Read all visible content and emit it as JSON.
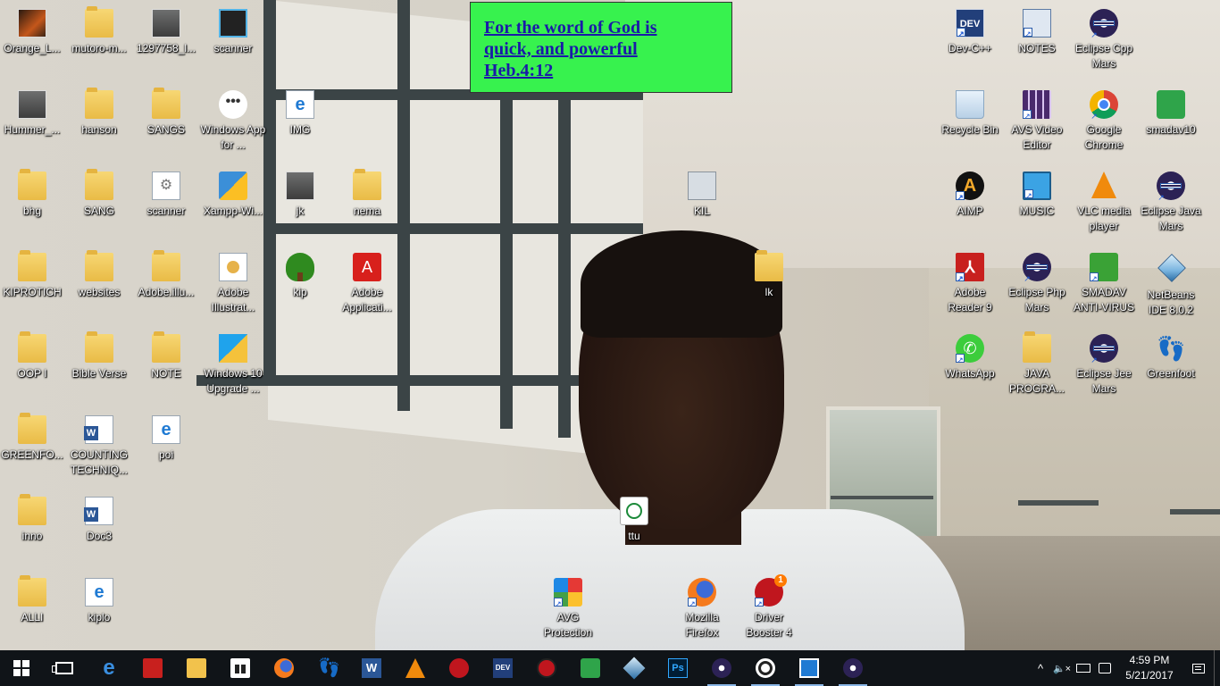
{
  "verse": {
    "line1": "For the word of God is",
    "line2": "quick, and powerful",
    "line3": "Heb.4:12"
  },
  "desktop_icons": {
    "orange_l": "Orange_L...",
    "mutoro": "mutoro-m...",
    "img1297758": "1297758_l...",
    "scanner_top": "scanner",
    "hummer": "Hummer_...",
    "hanson": "hanson",
    "sangs": "SANGS",
    "windows_app": "Windows App for ...",
    "img": "IMG",
    "bhg": "bhg",
    "sang": "SANG",
    "scanner": "scanner",
    "xampp": "Xampp-Wi...",
    "jk": "jk",
    "nema": "nema",
    "kiprotich": "KIPROTICH",
    "websites": "websites",
    "adobe_illu": "Adobe.illu...",
    "adobe_illustrat": "Adobe Illustrat...",
    "kip": "kip",
    "adobe_applicati": "Adobe Applicati...",
    "oop": "OOP I",
    "bible_verse": "Bible Verse",
    "note": "NOTE",
    "win10_upgrade": "Windows 10 Upgrade ...",
    "greenfo": "GREENFO...",
    "counting": "COUNTING TECHNIQ...",
    "poi": "poi",
    "inno": "inno",
    "doc3": "Doc3",
    "alli": "ALLI",
    "kiplo": "kiplo",
    "kil": "KIL",
    "lk": "lk",
    "ttu": "ttu",
    "avg": "AVG Protection",
    "firefox": "Mozilla Firefox",
    "driver_booster": "Driver Booster 4",
    "driver_booster_badge": "1",
    "devcpp": "Dev-C++",
    "notes": "NOTES",
    "eclipse_cpp": "Eclipse Cpp Mars",
    "recycle_bin": "Recycle Bin",
    "avs": "AVS Video Editor",
    "chrome": "Google Chrome",
    "smadav10": "smadav10",
    "aimp": "AIMP",
    "music": "MUSIC",
    "vlc": "VLC media player",
    "eclipse_java": "Eclipse Java Mars",
    "adobe_reader": "Adobe Reader 9",
    "eclipse_php": "Eclipse Php Mars",
    "smadav_av": "SMADAV ANTI-VIRUS",
    "netbeans": "NetBeans IDE 8.0.2",
    "whatsapp": "WhatsApp",
    "java_progra": "JAVA PROGRA...",
    "eclipse_jee": "Eclipse Jee Mars",
    "greenfoot": "Greenfoot"
  },
  "taskbar": {
    "apps": [
      "start-icon",
      "task-view-icon",
      "edge-icon",
      "acrobat-icon",
      "file-explorer-icon",
      "store-icon",
      "firefox-icon",
      "greenfoot-icon",
      "word-icon",
      "vlc-icon",
      "driver-booster-icon",
      "devcpp-icon",
      "driver-genius-icon",
      "smadav-icon",
      "netbeans-icon",
      "photoshop-icon",
      "eclipse-icon",
      "whatsapp-icon",
      "window-app-icon",
      "eclipse-icon"
    ],
    "word_label": "W",
    "dev_label": "DEV",
    "ps_label": "Ps",
    "time": "4:59 PM",
    "date": "5/21/2017",
    "tray_chevron": "^",
    "volume": "🔈×",
    "colors": {
      "taskbar_bg": "#101418",
      "verse_bg": "#37f24e",
      "verse_text": "#1a1aa8"
    }
  }
}
